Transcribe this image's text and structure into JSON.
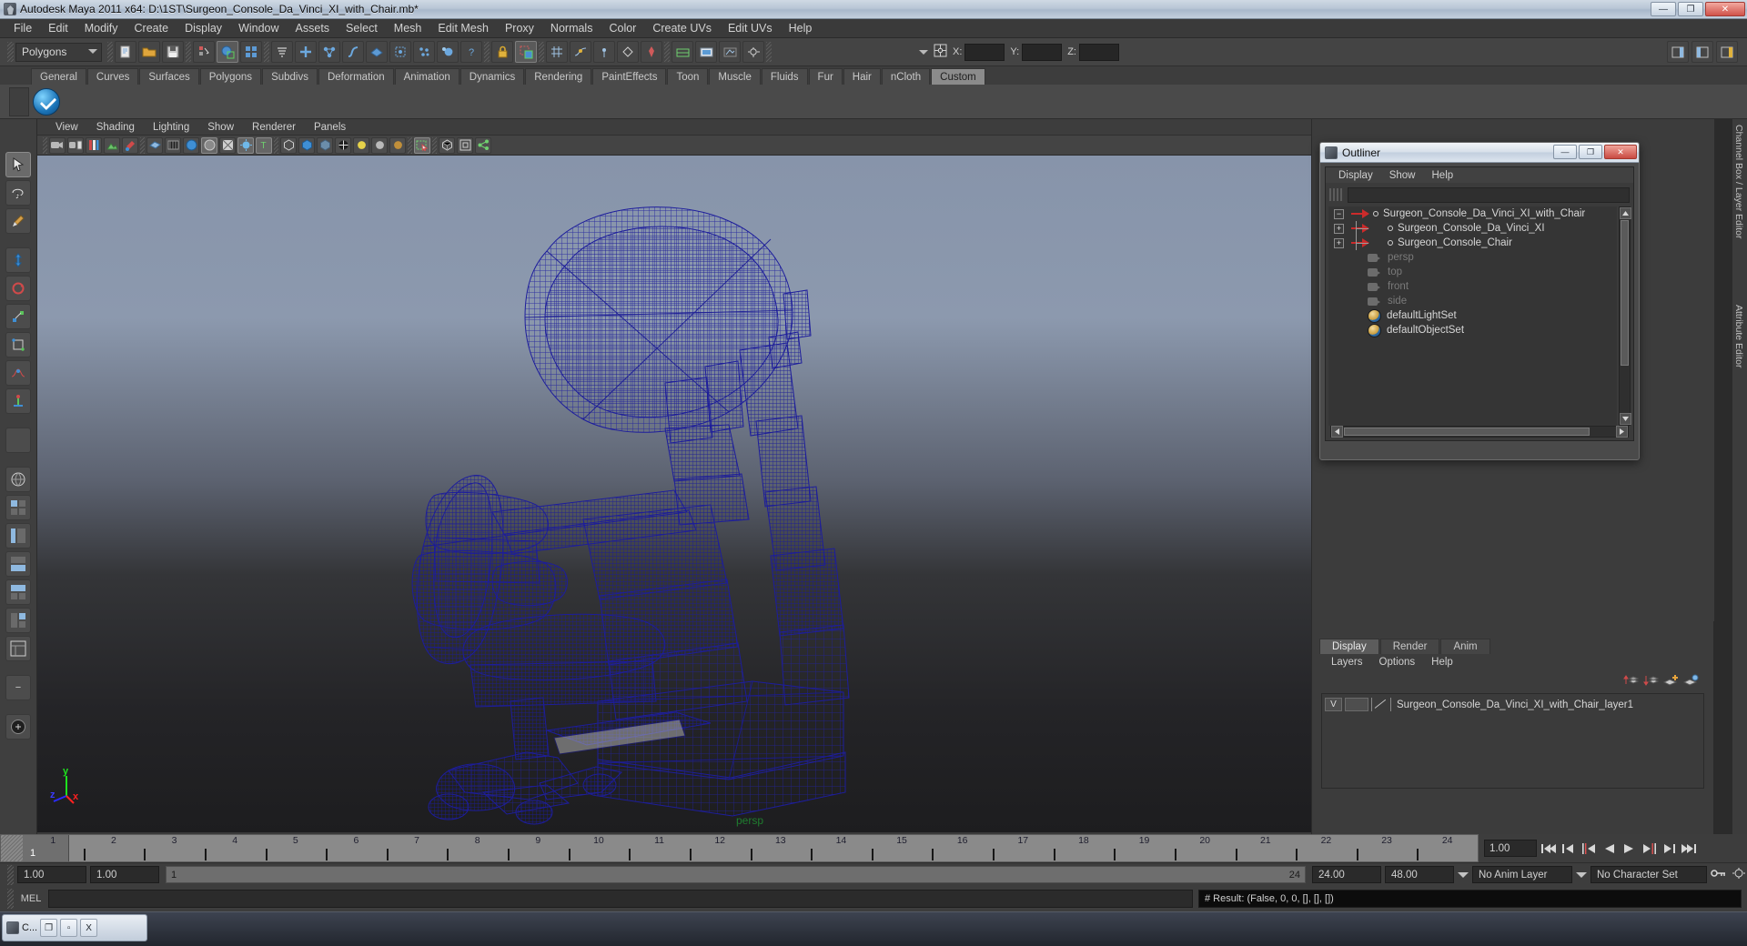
{
  "window": {
    "title": "Autodesk Maya 2011 x64: D:\\1ST\\Surgeon_Console_Da_Vinci_XI_with_Chair.mb*",
    "minimize": "—",
    "maximize": "❐",
    "close": "✕"
  },
  "menubar": {
    "items": [
      "File",
      "Edit",
      "Modify",
      "Create",
      "Display",
      "Window",
      "Assets",
      "Select",
      "Mesh",
      "Edit Mesh",
      "Proxy",
      "Normals",
      "Color",
      "Create UVs",
      "Edit UVs",
      "Help"
    ]
  },
  "statusline": {
    "mode_menu": "Polygons",
    "axis_labels": {
      "x": "X:",
      "y": "Y:",
      "z": "Z:"
    },
    "x_value": "",
    "y_value": "",
    "z_value": ""
  },
  "shelf": {
    "tabs": [
      "General",
      "Curves",
      "Surfaces",
      "Polygons",
      "Subdivs",
      "Deformation",
      "Animation",
      "Dynamics",
      "Rendering",
      "PaintEffects",
      "Toon",
      "Muscle",
      "Fluids",
      "Fur",
      "Hair",
      "nCloth",
      "Custom"
    ],
    "active_tab": "Custom"
  },
  "viewport": {
    "menu": [
      "View",
      "Shading",
      "Lighting",
      "Show",
      "Renderer",
      "Panels"
    ],
    "camera_label": "persp",
    "axis": {
      "x": "x",
      "y": "y",
      "z": "z"
    },
    "model_color": "#1b1b9e",
    "bg_top": "#8794aa",
    "bg_bottom": "#1d1d1f"
  },
  "outliner": {
    "title": "Outliner",
    "menu": [
      "Display",
      "Show",
      "Help"
    ],
    "search_value": "",
    "tree": [
      {
        "label": "Surgeon_Console_Da_Vinci_XI_with_Chair",
        "type": "transform",
        "expander": "−",
        "depth": 0
      },
      {
        "label": "Surgeon_Console_Da_Vinci_XI",
        "type": "transform",
        "expander": "+",
        "depth": 1
      },
      {
        "label": "Surgeon_Console_Chair",
        "type": "transform",
        "expander": "+",
        "depth": 1
      },
      {
        "label": "persp",
        "type": "camera",
        "expander": "",
        "depth": 0,
        "dim": true
      },
      {
        "label": "top",
        "type": "camera",
        "expander": "",
        "depth": 0,
        "dim": true
      },
      {
        "label": "front",
        "type": "camera",
        "expander": "",
        "depth": 0,
        "dim": true
      },
      {
        "label": "side",
        "type": "camera",
        "expander": "",
        "depth": 0,
        "dim": true
      },
      {
        "label": "defaultLightSet",
        "type": "set",
        "expander": "",
        "depth": 0,
        "dim": false
      },
      {
        "label": "defaultObjectSet",
        "type": "set",
        "expander": "",
        "depth": 0,
        "dim": false
      }
    ],
    "win_buttons": {
      "min": "—",
      "max": "❐",
      "close": "✕"
    }
  },
  "layer_editor": {
    "tabs": [
      "Display",
      "Render",
      "Anim"
    ],
    "active_tab": "Display",
    "menu": [
      "Layers",
      "Options",
      "Help"
    ],
    "layers": [
      {
        "visibility": "V",
        "type": "",
        "name": "Surgeon_Console_Da_Vinci_XI_with_Chair_layer1"
      }
    ]
  },
  "right_tabs": [
    "Channel Box / Layer Editor",
    "Attribute Editor"
  ],
  "time_slider": {
    "ticks": [
      1,
      2,
      3,
      4,
      5,
      6,
      7,
      8,
      9,
      10,
      11,
      12,
      13,
      14,
      15,
      16,
      17,
      18,
      19,
      20,
      21,
      22,
      23,
      24
    ],
    "current_frame": "1",
    "current_field": "1.00",
    "playback_buttons": [
      "go-to-start",
      "step-back-key",
      "step-back-frame",
      "play-backwards",
      "play-forwards",
      "step-forward-frame",
      "step-forward-key",
      "go-to-end"
    ]
  },
  "range_slider": {
    "anim_start": "1.00",
    "range_start": "1.00",
    "bar_start": "1",
    "bar_end": "24",
    "range_end": "24.00",
    "anim_end": "48.00",
    "anim_layer": "No Anim Layer",
    "character_set": "No Character Set"
  },
  "command_line": {
    "language": "MEL",
    "input_value": "",
    "result": "# Result: (False, 0, 0, [], [], [])"
  },
  "taskbar": {
    "item_label": "C...",
    "buttons": [
      "❐",
      "▫",
      "X"
    ]
  }
}
